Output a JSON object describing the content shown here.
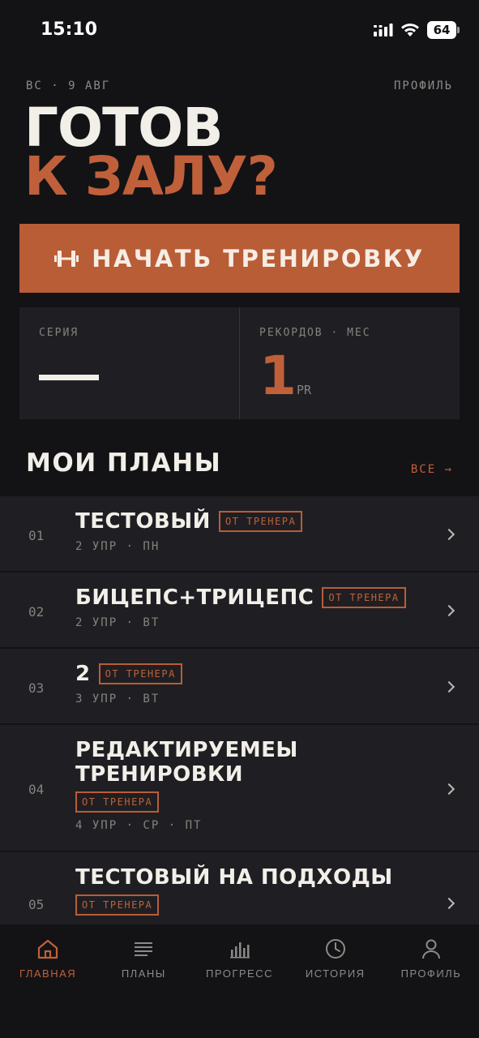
{
  "status_bar": {
    "time": "15:10",
    "battery": "64"
  },
  "header": {
    "date": "ВС · 9 АВГ",
    "profile_link": "ПРОФИЛЬ"
  },
  "headline": {
    "line1": "ГОТОВ",
    "line2": "К ЗАЛУ?"
  },
  "start_button": {
    "label": "НАЧАТЬ ТРЕНИРОВКУ",
    "icon": "dumbbell-icon"
  },
  "stats": {
    "streak": {
      "label": "СЕРИЯ",
      "value": "—"
    },
    "records": {
      "label": "РЕКОРДОВ · МЕС",
      "value": "1",
      "unit": "PR"
    }
  },
  "plans_section": {
    "title": "МОИ ПЛАНЫ",
    "all_link": "ВСЕ →"
  },
  "plans": [
    {
      "num": "01",
      "title": "ТЕСТОВЫЙ",
      "badge": "ОТ ТРЕНЕРА",
      "sub": "2 УПР · ПН"
    },
    {
      "num": "02",
      "title": "БИЦЕПС+ТРИЦЕПС",
      "badge": "ОТ ТРЕНЕРА",
      "sub": "2 УПР · ВТ"
    },
    {
      "num": "03",
      "title": "2",
      "badge": "ОТ ТРЕНЕРА",
      "sub": "3 УПР · ВТ"
    },
    {
      "num": "04",
      "title": "РЕДАКТИРУЕМЕЫ ТРЕНИРОВКИ",
      "badge": "ОТ ТРЕНЕРА",
      "sub": "4 УПР · СР · ПТ"
    },
    {
      "num": "05",
      "title": "ТЕСТОВЫЙ НА ПОДХОДЫ",
      "badge": "ОТ ТРЕНЕРА",
      "sub": ""
    }
  ],
  "tabbar": [
    {
      "label": "ГЛАВНАЯ",
      "icon": "home-icon",
      "active": true
    },
    {
      "label": "ПЛАНЫ",
      "icon": "list-icon",
      "active": false
    },
    {
      "label": "ПРОГРЕСС",
      "icon": "bar-chart-icon",
      "active": false
    },
    {
      "label": "ИСТОРИЯ",
      "icon": "clock-icon",
      "active": false
    },
    {
      "label": "ПРОФИЛЬ",
      "icon": "user-icon",
      "active": false
    }
  ],
  "colors": {
    "accent": "#b95d37",
    "background": "#131316",
    "card": "#1f1f23",
    "text": "#f2efe9",
    "muted": "#85827d"
  }
}
